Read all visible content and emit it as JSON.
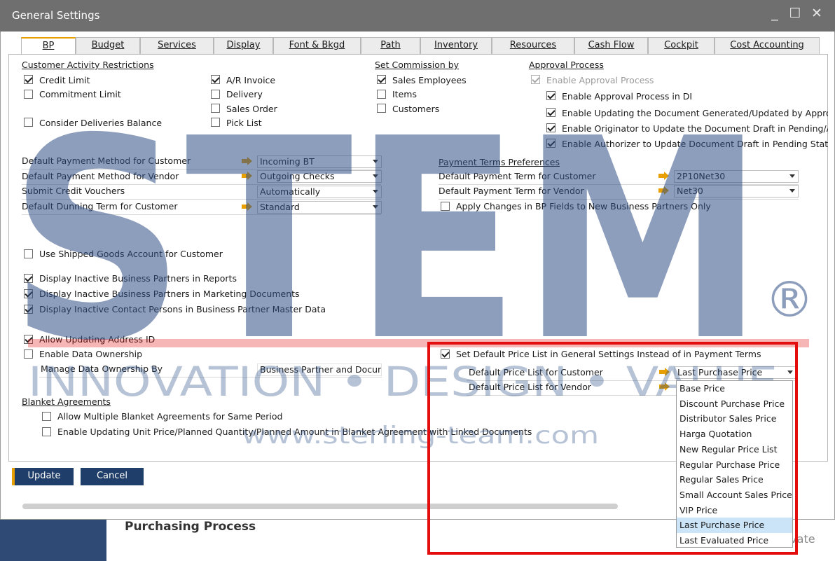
{
  "window": {
    "title": "General Settings",
    "controls": {
      "minimize": "_",
      "maximize": "☐",
      "close": "✕"
    }
  },
  "tabs": [
    {
      "label": "BP",
      "active": true
    },
    {
      "label": "Budget"
    },
    {
      "label": "Services"
    },
    {
      "label": "Display"
    },
    {
      "label": "Font & Bkgd"
    },
    {
      "label": "Path"
    },
    {
      "label": "Inventory"
    },
    {
      "label": "Resources"
    },
    {
      "label": "Cash Flow"
    },
    {
      "label": "Cockpit"
    },
    {
      "label": "Cost Accounting"
    }
  ],
  "customer_activity": {
    "header": "Customer Activity Restrictions",
    "credit_limit": "Credit Limit",
    "commitment_limit": "Commitment Limit",
    "consider_deliveries": "Consider Deliveries Balance",
    "ar_invoice": "A/R Invoice",
    "delivery": "Delivery",
    "sales_order": "Sales Order",
    "pick_list": "Pick List"
  },
  "commission": {
    "header": "Set Commission by",
    "sales_employees": "Sales Employees",
    "items": "Items",
    "customers": "Customers"
  },
  "approval": {
    "header": "Approval Process",
    "enable": "Enable Approval Process",
    "di": "Enable Approval Process in DI",
    "updating": "Enable Updating the Document Generated/Updated by Appro",
    "originator": "Enable Originator to Update the Document Draft in Pending/A",
    "authorizer": "Enable Authorizer to Update Document Draft in Pending Statu"
  },
  "payment": {
    "customer_method_label": "Default Payment Method for Customer",
    "customer_method_value": "Incoming BT",
    "vendor_method_label": "Default Payment Method for Vendor",
    "vendor_method_value": "Outgoing Checks",
    "credit_vouchers_label": "Submit Credit Vouchers",
    "credit_vouchers_value": "Automatically",
    "dunning_label": "Default Dunning Term for Customer",
    "dunning_value": "Standard"
  },
  "payment_terms": {
    "header": "Payment Terms Preferences",
    "customer_label": "Default Payment Term for Customer",
    "customer_value": "2P10Net30",
    "vendor_label": "Default Payment Term for Vendor",
    "vendor_value": "Net30",
    "apply_changes": "Apply Changes in BP Fields to New Business Partners Only"
  },
  "options": {
    "shipped_goods": "Use Shipped Goods Account for Customer",
    "inactive_reports": "Display Inactive Business Partners in Reports",
    "inactive_marketing": "Display Inactive Business Partners in Marketing Documents",
    "inactive_contacts": "Display Inactive Contact Persons in Business Partner Master Data",
    "address_id": "Allow Updating Address ID",
    "data_ownership": "Enable Data Ownership",
    "manage_ownership_label": "Manage Data Ownership By",
    "manage_ownership_value": "Business Partner and Document"
  },
  "price_list": {
    "set_default": "Set Default Price List in General Settings Instead of in Payment Terms",
    "customer_label": "Default Price List for Customer",
    "customer_value": "Last Purchase Price",
    "vendor_label": "Default Price List for Vendor",
    "options": [
      "Base Price",
      "Discount Purchase Price",
      "Distributor Sales Price",
      "Harga Quotation",
      "New Regular Price List",
      "Regular Purchase Price",
      "Regular Sales Price",
      "Small Account Sales Price",
      "VIP Price",
      "Last Purchase Price",
      "Last Evaluated Price"
    ],
    "highlighted": "Last Purchase Price"
  },
  "blanket": {
    "header": "Blanket Agreements",
    "multiple": "Allow Multiple Blanket Agreements for Same Period",
    "updating": "Enable Updating Unit Price/Planned Quantity/Planned Amount in Blanket Agreement with Linked Documents"
  },
  "buttons": {
    "update": "Update",
    "cancel": "Cancel"
  },
  "background": {
    "section_title": "Purchasing Process",
    "activate": "Activate"
  },
  "watermark": {
    "brand": "STEM",
    "registered": "®",
    "tagline": "INNOVATION • DESIGN • VALUE",
    "url": "www.sterling-team.com"
  },
  "colors": {
    "accent": "#e7a000",
    "button": "#1f3f6a",
    "highlight_box": "#e30d0d",
    "watermark": "#2f4f86"
  }
}
